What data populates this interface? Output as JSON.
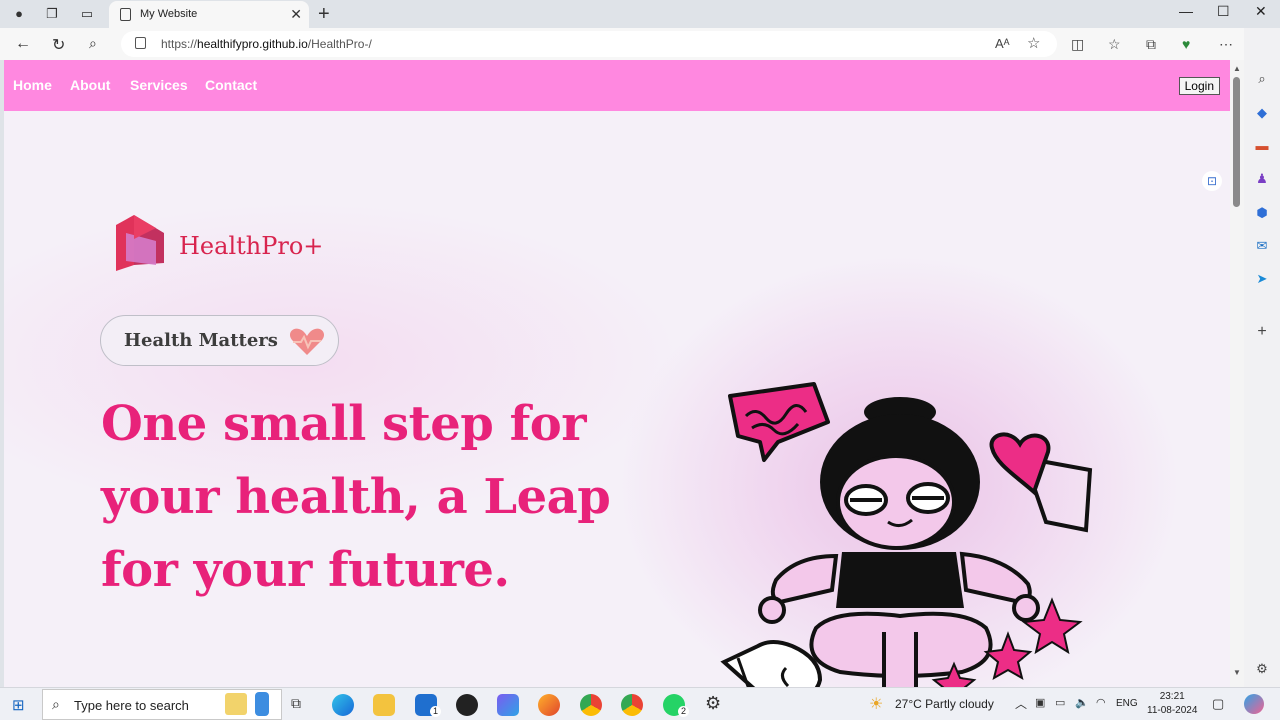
{
  "browser": {
    "tab_title": "My Website",
    "url_prefix": "https://",
    "url_host": "healthifypro.github.io",
    "url_path": "/HealthPro-/"
  },
  "nav": {
    "links": [
      "Home",
      "About",
      "Services",
      "Contact"
    ],
    "login_label": "Login"
  },
  "hero": {
    "brand": "HealthPro+",
    "pill_text": "Health Matters",
    "headline_lines": [
      "One small step for",
      "your health, a Leap",
      "for your future."
    ]
  },
  "taskbar": {
    "search_placeholder": "Type here to search",
    "weather": "27°C  Partly cloudy",
    "language": "ENG",
    "time": "23:21",
    "date": "11-08-2024",
    "mail_badge": "1",
    "whatsapp_badge": "2"
  },
  "colors": {
    "navbar": "#ff88e0",
    "accent": "#e8227a",
    "brand": "#d8244e"
  }
}
